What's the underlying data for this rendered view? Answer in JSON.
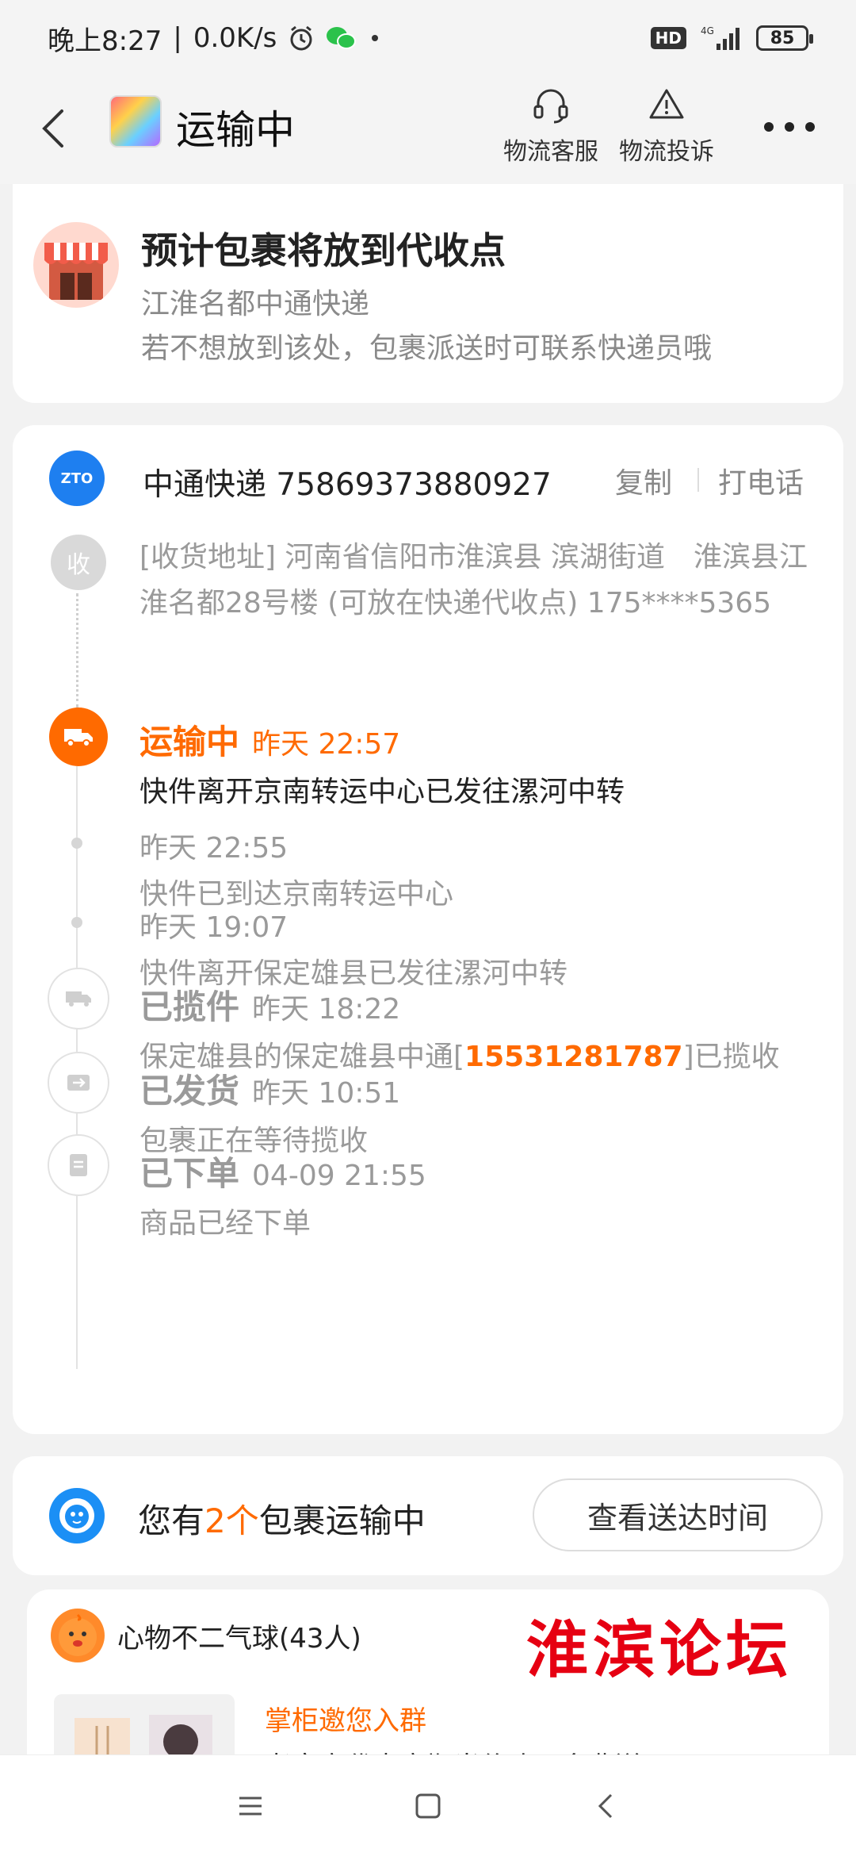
{
  "status_bar": {
    "time_label": "晚上8:27",
    "speed": "0.0K/s",
    "hd": "HD",
    "network": "4G",
    "battery": "85"
  },
  "nav": {
    "title": "运输中",
    "actions": [
      {
        "label": "物流客服",
        "icon": "headset-icon"
      },
      {
        "label": "物流投诉",
        "icon": "warning-icon"
      }
    ]
  },
  "pickup_notice": {
    "title": "预计包裹将放到代收点",
    "location": "江淮名都中通快递",
    "hint": "若不想放到该处，包裹派送时可联系快递员哦"
  },
  "shipment": {
    "carrier": "中通快递",
    "tracking_no": "75869373880927",
    "copy_label": "复制",
    "call_label": "打电话",
    "recv_badge": "收",
    "address": "[收货地址] 河南省信阳市淮滨县 滨湖街道　淮滨县江淮名都28号楼 (可放在快递代收点) 175****5365",
    "events": [
      {
        "status": "运输中",
        "time": "昨天 22:57",
        "desc": "快件离开京南转运中心已发往漯河中转"
      },
      {
        "status": "",
        "time": "昨天 22:55",
        "desc": "快件已到达京南转运中心"
      },
      {
        "status": "",
        "time": "昨天 19:07",
        "desc": "快件离开保定雄县已发往漯河中转"
      },
      {
        "status": "已揽件",
        "time": "昨天 18:22",
        "desc_pre": "保定雄县的保定雄县中通[",
        "desc_phone": "15531281787",
        "desc_post": "]已揽收"
      },
      {
        "status": "已发货",
        "time": "昨天 10:51",
        "desc": "包裹正在等待揽收"
      },
      {
        "status": "已下单",
        "time": "04-09 21:55",
        "desc": "商品已经下单"
      }
    ]
  },
  "packages": {
    "prefix": "您有",
    "count": "2个",
    "suffix": "包裹运输中",
    "button": "查看送达时间"
  },
  "group": {
    "name": "心物不二气球(43人)",
    "watermark": "淮滨论坛",
    "invite_title": "掌柜邀您入群",
    "invite_sub": "老客户代表官期当价购买多费送"
  },
  "colors": {
    "accent": "#ff6a00",
    "zto_blue": "#1e7ff0",
    "watermark_red": "#e60012"
  }
}
